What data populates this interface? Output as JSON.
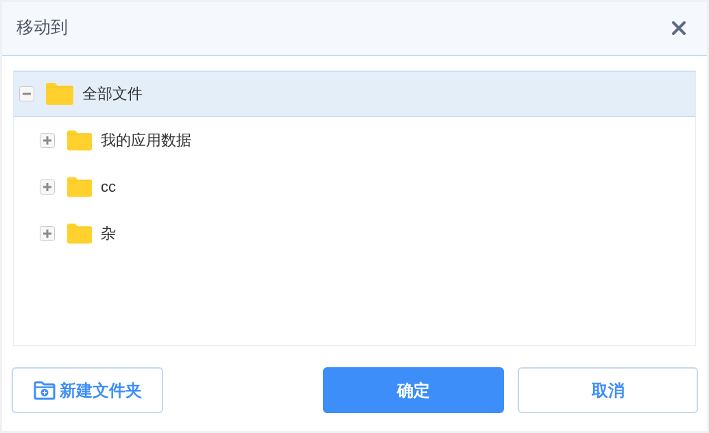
{
  "dialog": {
    "title": "移动到"
  },
  "tree": {
    "label": "全部文件",
    "expanded": true,
    "selected": true,
    "children": [
      {
        "label": "我的应用数据",
        "expanded": false,
        "selected": false
      },
      {
        "label": "cc",
        "expanded": false,
        "selected": false
      },
      {
        "label": "杂",
        "expanded": false,
        "selected": false
      }
    ]
  },
  "buttons": [
    {
      "kind": "new-folder",
      "label": "新建文件夹"
    },
    {
      "kind": "primary",
      "label": "确定"
    },
    {
      "kind": "secondary",
      "label": "取消"
    }
  ]
}
